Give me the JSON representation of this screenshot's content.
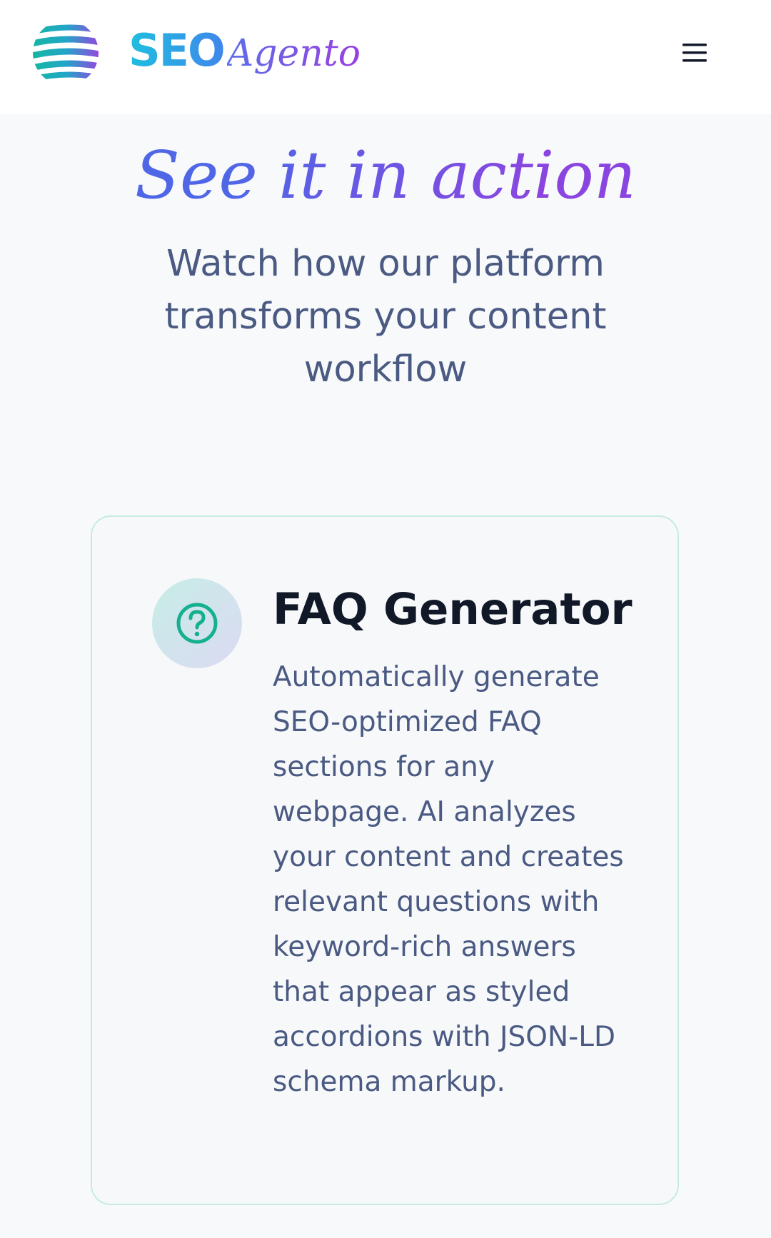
{
  "header": {
    "brand_seo": "SEO",
    "brand_agento": "Agento",
    "logo_icon": "globe-stripes-icon",
    "menu_icon": "hamburger-menu-icon"
  },
  "section": {
    "title": "See it in action",
    "subtitle": "Watch how our platform transforms your content workflow"
  },
  "feature_card": {
    "icon": "question-circle-icon",
    "title": "FAQ Generator",
    "description": "Automatically generate SEO-optimized FAQ sections for any webpage. AI analyzes your content and creates relevant questions with keyword-rich answers that appear as styled accordions with JSON-LD schema markup."
  },
  "colors": {
    "brand_cyan": "#1fbfe0",
    "brand_purple": "#9a3fe0",
    "accent_teal": "#14b08f",
    "heading": "#111827",
    "body_text": "#4a5a82"
  }
}
